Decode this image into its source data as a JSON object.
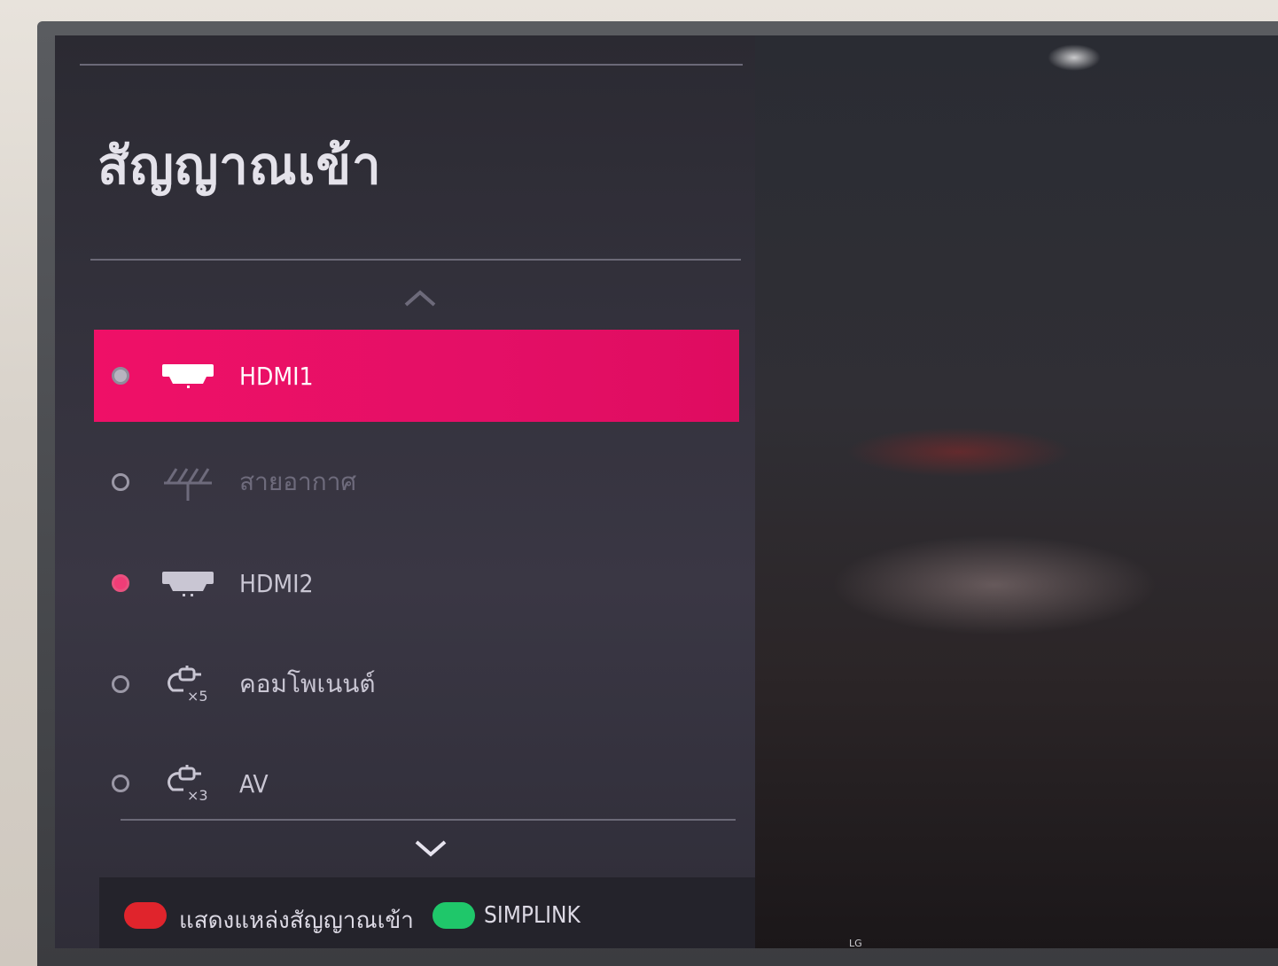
{
  "menu": {
    "title": "สัญญาณเข้า",
    "items": [
      {
        "label": "HDMI1",
        "icon": "hdmi-icon",
        "state": "selected"
      },
      {
        "label": "สายอากาศ",
        "icon": "antenna-icon",
        "state": "dimmed"
      },
      {
        "label": "HDMI2",
        "icon": "hdmi-icon",
        "state": "active"
      },
      {
        "label": "คอมโพเนนต์",
        "icon": "component-cable-icon",
        "multiplier": "×5"
      },
      {
        "label": "AV",
        "icon": "av-cable-icon",
        "multiplier": "×3"
      }
    ]
  },
  "footer": {
    "red_label": "แสดงแหล่งสัญญาณเข้า",
    "green_label": "SIMPLINK"
  },
  "brand": "LG",
  "colors": {
    "selection": "#e40f66",
    "active_radio": "#f03d77",
    "red_key": "#e0242c",
    "green_key": "#1fc76a"
  }
}
